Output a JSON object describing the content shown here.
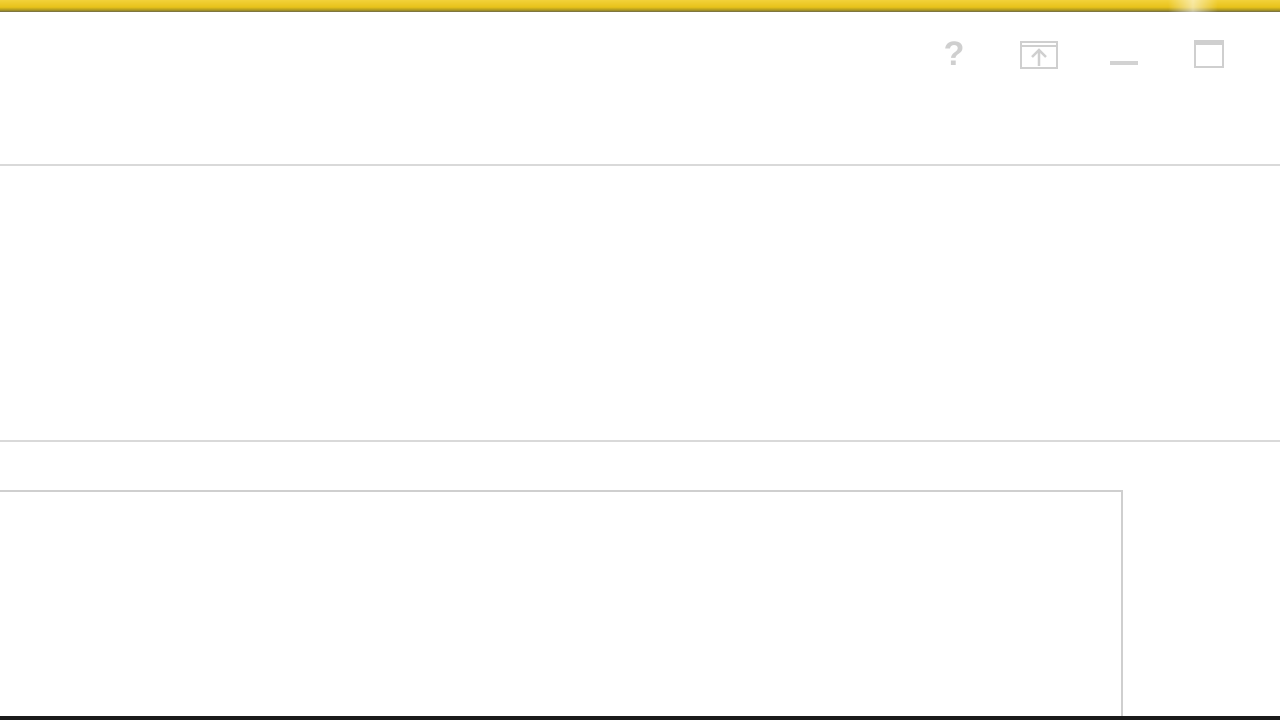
{
  "window": {
    "accent_color": "#e8c21a",
    "title_controls": [
      {
        "name": "help",
        "icon": "question-mark-icon",
        "glyph": "?"
      },
      {
        "name": "share",
        "icon": "upload-box-icon"
      },
      {
        "name": "minimize",
        "icon": "minimize-icon"
      },
      {
        "name": "maximize",
        "icon": "maximize-icon"
      }
    ]
  }
}
